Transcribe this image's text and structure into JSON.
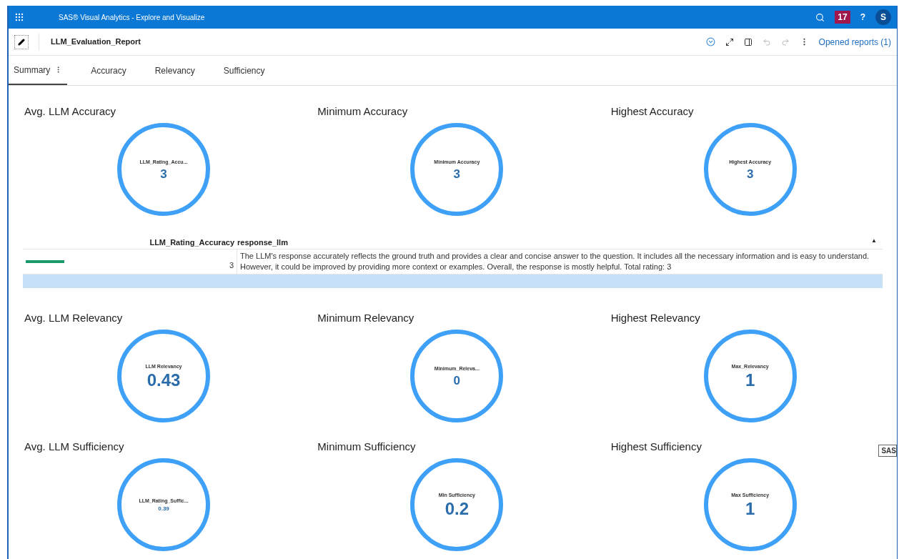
{
  "app_bar": {
    "title": "SAS® Visual Analytics - Explore and Visualize",
    "notification_count": "17",
    "help": "?",
    "avatar": "S"
  },
  "report": {
    "title": "LLM_Evaluation_Report",
    "undo_disabled": true,
    "redo_disabled": true,
    "opened_reports": "Opened reports (1)"
  },
  "tabs": [
    {
      "label": "Summary",
      "selected": true
    },
    {
      "label": "Accuracy",
      "selected": false
    },
    {
      "label": "Relevancy",
      "selected": false
    },
    {
      "label": "Sufficiency",
      "selected": false
    }
  ],
  "kpi_rows": [
    {
      "kind": "kpis",
      "tiles": [
        {
          "title": "Avg. LLM Accuracy",
          "label": "LLM_Rating_Accu...",
          "value": "3",
          "value_large": false,
          "value_small": false
        },
        {
          "title": "Minimum Accuracy",
          "label": "Minimum Accuracy",
          "value": "3",
          "value_large": false,
          "value_small": false
        },
        {
          "title": "Highest Accuracy",
          "label": "Highest Accuracy",
          "value": "3",
          "value_large": false,
          "value_small": false
        }
      ]
    },
    {
      "kind": "table",
      "columns": [
        "LLM_Rating_Accuracy",
        "response_llm"
      ],
      "sort_indicator": "▲",
      "rows": [
        {
          "selected": false,
          "level": 0.15,
          "rating": "3",
          "response": "The LLM's response accurately reflects the ground truth and provides a clear and concise answer to the question. It includes all the necessary information and is easy to understand. However, it could be improved by providing more context or examples. Overall, the response is mostly helpful. Total rating: 3"
        },
        {
          "selected": true
        }
      ]
    },
    {
      "kind": "kpis",
      "tiles": [
        {
          "title": "Avg. LLM Relevancy",
          "label": "LLM Relevancy",
          "value": "0.43",
          "value_large": true,
          "value_small": false
        },
        {
          "title": "Minimum Relevancy",
          "label": "Minimum_Releva...",
          "value": "0",
          "value_large": false,
          "value_small": false
        },
        {
          "title": "Highest Relevancy",
          "label": "Max_Relevancy",
          "value": "1",
          "value_large": true,
          "value_small": false
        }
      ]
    },
    {
      "kind": "kpis",
      "tiles": [
        {
          "title": "Avg. LLM Sufficiency",
          "label": "LLM_Rating_Suffic...",
          "value": "0.39",
          "value_large": false,
          "value_small": true
        },
        {
          "title": "Minimum Sufficiency",
          "label": "Min Sufficiency",
          "value": "0.2",
          "value_large": true,
          "value_small": false
        },
        {
          "title": "Highest Sufficiency",
          "label": "Max Sufficiency",
          "value": "1",
          "value_large": true,
          "value_small": false
        }
      ]
    }
  ],
  "tooltip": {
    "text": "SAS"
  }
}
